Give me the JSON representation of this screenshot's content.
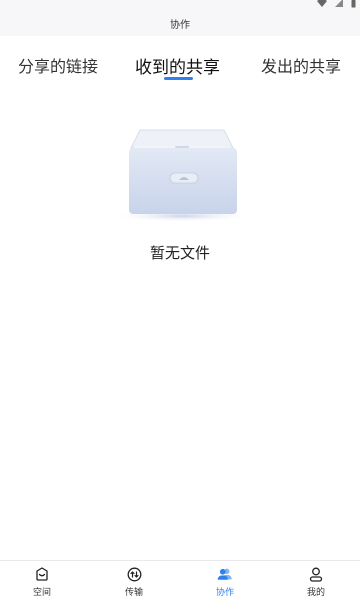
{
  "header": {
    "title": "协作"
  },
  "tabs": [
    {
      "label": "分享的链接"
    },
    {
      "label": "收到的共享"
    },
    {
      "label": "发出的共享"
    }
  ],
  "active_tab_index": 1,
  "empty_state": {
    "message": "暂无文件",
    "icon": "empty-box-icon"
  },
  "bottom_nav": [
    {
      "label": "空间",
      "icon": "space-icon"
    },
    {
      "label": "传输",
      "icon": "transfer-icon"
    },
    {
      "label": "协作",
      "icon": "collaborate-icon",
      "active": true
    },
    {
      "label": "我的",
      "icon": "user-icon"
    }
  ],
  "colors": {
    "accent": "#2f80ed",
    "text": "#222222",
    "header_bg": "#f7f7f9"
  }
}
